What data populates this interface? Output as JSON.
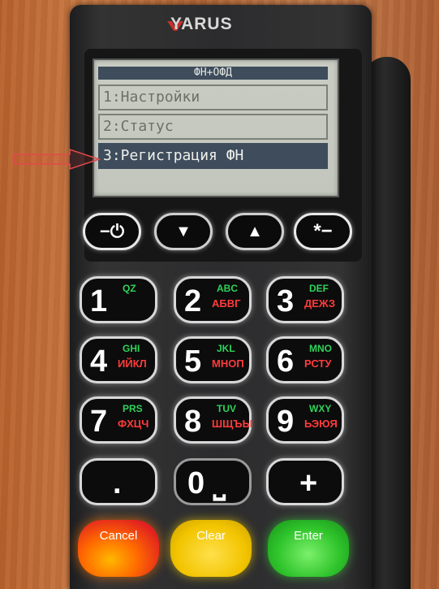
{
  "device": {
    "brand": "YARUS"
  },
  "screen": {
    "title": "ФН+ОФД",
    "items": [
      {
        "label": "1:Настройки",
        "selected": false
      },
      {
        "label": "2:Статус",
        "selected": false
      },
      {
        "label": "3:Регистрация ФН",
        "selected": true
      }
    ]
  },
  "function_keys": [
    {
      "icon": "minus-power-icon",
      "label": "−⏻"
    },
    {
      "icon": "arrow-down-icon",
      "label": "▼"
    },
    {
      "icon": "arrow-up-icon",
      "label": "▲"
    },
    {
      "icon": "star-minus-icon",
      "label": "*−"
    }
  ],
  "keypad": [
    {
      "num": "1",
      "lat": "QZ",
      "cyr": ""
    },
    {
      "num": "2",
      "lat": "ABC",
      "cyr": "АБВГ"
    },
    {
      "num": "3",
      "lat": "DEF",
      "cyr": "ДЕЖЗ"
    },
    {
      "num": "4",
      "lat": "GHI",
      "cyr": "ИЙКЛ"
    },
    {
      "num": "5",
      "lat": "JKL",
      "cyr": "МНОП"
    },
    {
      "num": "6",
      "lat": "MNO",
      "cyr": "РСТУ"
    },
    {
      "num": "7",
      "lat": "PRS",
      "cyr": "ФХЦЧ"
    },
    {
      "num": "8",
      "lat": "TUV",
      "cyr": "ШЩЪЫ"
    },
    {
      "num": "9",
      "lat": "WXY",
      "cyr": "ЬЭЮЯ"
    },
    {
      "num": ".",
      "lat": "",
      "cyr": ""
    },
    {
      "num": "0 ⎵",
      "lat": "",
      "cyr": ""
    },
    {
      "num": "+",
      "lat": "",
      "cyr": ""
    }
  ],
  "control_keys": {
    "cancel": "Cancel",
    "clear": "Clear",
    "enter": "Enter"
  },
  "colors": {
    "lcd_bg": "#c6c9c0",
    "lcd_select": "#3e4c5c",
    "cancel": "#ff6a00",
    "clear": "#f2c400",
    "enter": "#2fc42b"
  }
}
